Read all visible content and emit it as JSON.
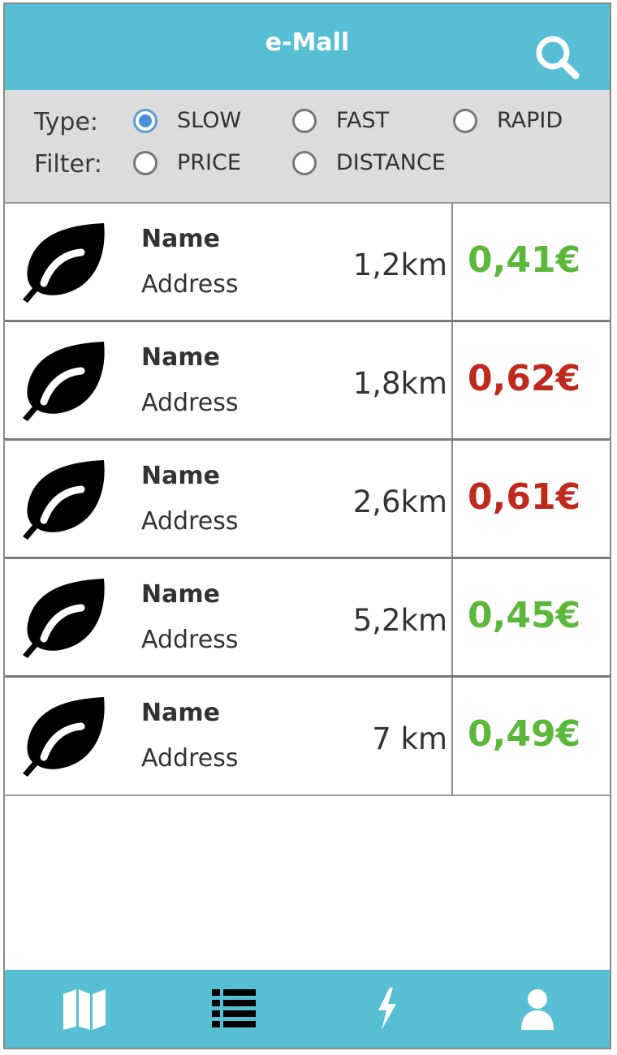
{
  "header": {
    "title": "e-Mall",
    "search_icon": "search-icon"
  },
  "filters": {
    "type_label": "Type:",
    "filter_label": "Filter:",
    "type_options": [
      {
        "label": "SLOW",
        "selected": true
      },
      {
        "label": "FAST",
        "selected": false
      },
      {
        "label": "RAPID",
        "selected": false
      }
    ],
    "filter_options": [
      {
        "label": "PRICE",
        "selected": false
      },
      {
        "label": "DISTANCE",
        "selected": false
      }
    ]
  },
  "stations": [
    {
      "name": "Name",
      "address": "Address",
      "distance": "1,2km",
      "price": "0,41€",
      "price_color": "#5cb83a"
    },
    {
      "name": "Name",
      "address": "Address",
      "distance": "1,8km",
      "price": "0,62€",
      "price_color": "#c0291e"
    },
    {
      "name": "Name",
      "address": "Address",
      "distance": "2,6km",
      "price": "0,61€",
      "price_color": "#c0291e"
    },
    {
      "name": "Name",
      "address": "Address",
      "distance": "5,2km",
      "price": "0,45€",
      "price_color": "#5cb83a"
    },
    {
      "name": "Name",
      "address": "Address",
      "distance": "7 km",
      "price": "0,49€",
      "price_color": "#5cb83a"
    }
  ],
  "nav": {
    "items": [
      {
        "icon": "map-icon"
      },
      {
        "icon": "list-icon"
      },
      {
        "icon": "bolt-icon"
      },
      {
        "icon": "user-icon"
      }
    ]
  },
  "colors": {
    "accent": "#56bfd4",
    "filter_bg": "#dcdcdc",
    "selected_radio": "#4a8fd6"
  }
}
